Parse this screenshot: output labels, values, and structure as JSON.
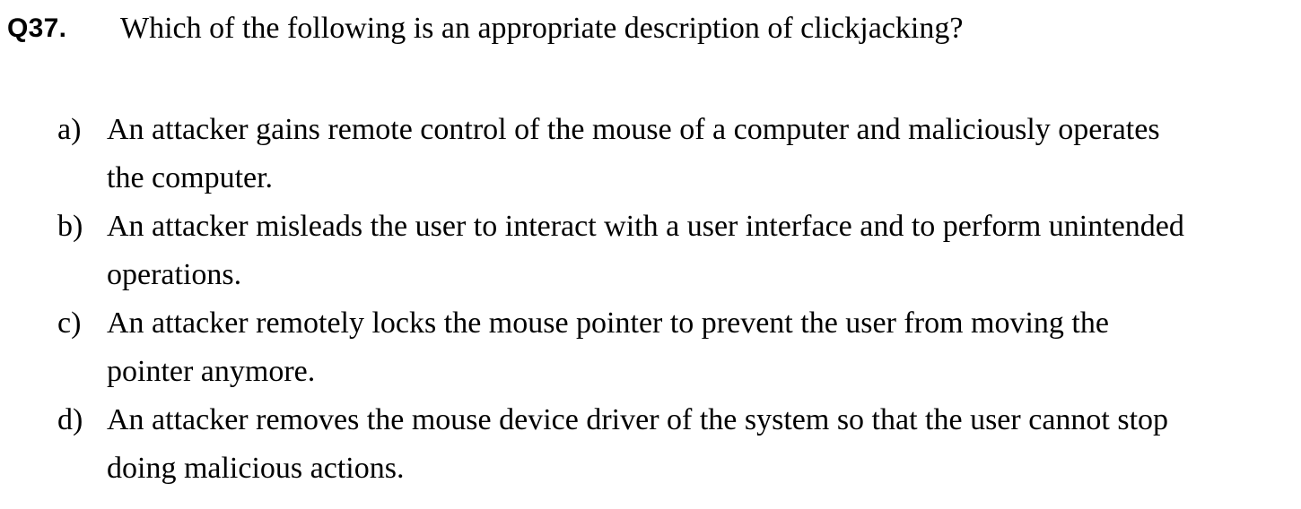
{
  "question": {
    "number": "Q37.",
    "text": "Which of the following is an appropriate description of clickjacking?"
  },
  "options": [
    {
      "letter": "a)",
      "line1": "An attacker gains remote control of the mouse of a computer and maliciously operates",
      "line2": "the computer."
    },
    {
      "letter": "b)",
      "line1": "An attacker misleads the user to interact with a user interface and to perform unintended",
      "line2": "operations."
    },
    {
      "letter": "c)",
      "line1": "An attacker remotely locks the mouse pointer to prevent the user from moving the",
      "line2": "pointer anymore."
    },
    {
      "letter": "d)",
      "line1": "An attacker removes the mouse device driver of the system so that the user cannot stop",
      "line2": "doing malicious actions."
    }
  ]
}
